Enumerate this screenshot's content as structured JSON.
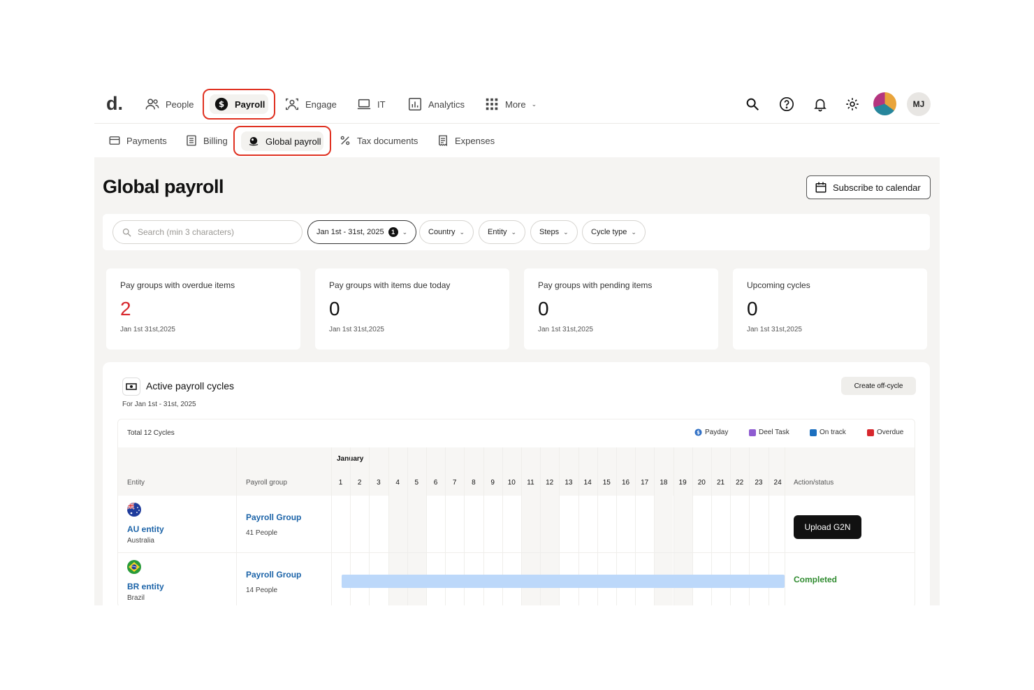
{
  "topnav": {
    "logo": "d.",
    "items": [
      {
        "label": "People",
        "icon": "people-icon"
      },
      {
        "label": "Payroll",
        "icon": "dollar-circle-icon"
      },
      {
        "label": "Engage",
        "icon": "engage-icon"
      },
      {
        "label": "IT",
        "icon": "laptop-icon"
      },
      {
        "label": "Analytics",
        "icon": "chart-icon"
      },
      {
        "label": "More",
        "icon": "grid-icon"
      }
    ],
    "avatar_initials": "MJ"
  },
  "subnav": {
    "items": [
      {
        "label": "Payments",
        "icon": "card-icon"
      },
      {
        "label": "Billing",
        "icon": "billing-icon"
      },
      {
        "label": "Global payroll",
        "icon": "globe-icon"
      },
      {
        "label": "Tax documents",
        "icon": "percent-icon"
      },
      {
        "label": "Expenses",
        "icon": "receipt-icon"
      }
    ]
  },
  "page": {
    "title": "Global payroll",
    "subscribe_label": "Subscribe to calendar"
  },
  "filters": {
    "search_placeholder": "Search (min 3 characters)",
    "date_range": "Jan 1st - 31st, 2025",
    "date_badge": "1",
    "country": "Country",
    "entity": "Entity",
    "steps": "Steps",
    "cycle_type": "Cycle type"
  },
  "cards": [
    {
      "title": "Pay groups with overdue items",
      "value": "2",
      "date": "Jan 1st 31st,2025"
    },
    {
      "title": "Pay groups with items due today",
      "value": "0",
      "date": "Jan 1st 31st,2025"
    },
    {
      "title": "Pay groups with pending items",
      "value": "0",
      "date": "Jan 1st 31st,2025"
    },
    {
      "title": "Upcoming cycles",
      "value": "0",
      "date": "Jan 1st 31st,2025"
    }
  ],
  "cycles": {
    "title": "Active payroll cycles",
    "subtitle": "For Jan 1st - 31st, 2025",
    "create_label": "Create off-cycle",
    "total": "Total 12 Cycles",
    "legend": [
      {
        "label": "Payday",
        "color": "#2f6fc5"
      },
      {
        "label": "Deel Task",
        "color": "#8e5bd1"
      },
      {
        "label": "On track",
        "color": "#1c6fbf"
      },
      {
        "label": "Overdue",
        "color": "#d7272d"
      }
    ],
    "month": "January",
    "col_entity": "Entity",
    "col_payroll_group": "Payroll group",
    "col_action": "Action/status",
    "days": [
      "1",
      "2",
      "3",
      "4",
      "5",
      "6",
      "7",
      "8",
      "9",
      "10",
      "11",
      "12",
      "13",
      "14",
      "15",
      "16",
      "17",
      "18",
      "19",
      "20",
      "21",
      "22",
      "23",
      "24"
    ],
    "rows": [
      {
        "entity": "AU entity",
        "country": "Australia",
        "group": "Payroll Group",
        "people": "41 People",
        "action": "Upload G2N"
      },
      {
        "entity": "BR entity",
        "country": "Brazil",
        "group": "Payroll Group",
        "people": "14 People",
        "status": "Completed"
      }
    ]
  }
}
